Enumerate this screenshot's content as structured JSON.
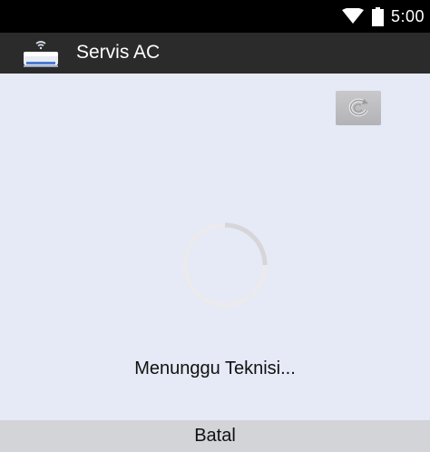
{
  "status_bar": {
    "time": "5:00",
    "wifi_icon": "wifi-icon",
    "battery_icon": "battery-icon"
  },
  "app_bar": {
    "icon": "air-conditioner-icon",
    "title": "Servis AC"
  },
  "refresh_button": {
    "icon": "refresh-icon"
  },
  "loading": {
    "icon": "spinner-icon",
    "message": "Menunggu Teknisi..."
  },
  "cancel_button": {
    "label": "Batal"
  },
  "colors": {
    "status_bar": "#000000",
    "app_bar": "#2b2b2b",
    "background": "#e6e9f6",
    "cancel_button": "#d2d4d8"
  }
}
